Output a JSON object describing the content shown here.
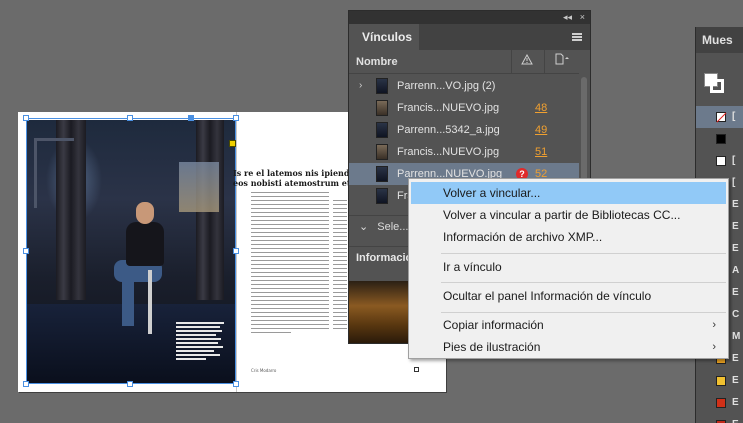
{
  "document": {
    "headline_line1": "Is re el latemos nis ipienda",
    "headline_line2": "eos nobisti atemostrum et et",
    "footer_text": "Cris Modarro"
  },
  "links_panel": {
    "title": "Vínculos",
    "collapse_glyph": "◂◂",
    "close_glyph": "×",
    "column_name": "Nombre",
    "column_status_icon": "warning-icon",
    "column_page_icon": "page-icon",
    "rows": [
      {
        "twisty": "›",
        "name": "Parrenn...VO.jpg (2)",
        "page": "",
        "missing": false
      },
      {
        "twisty": "",
        "name": "Francis...NUEVO.jpg",
        "page": "48",
        "missing": false
      },
      {
        "twisty": "",
        "name": "Parrenn...5342_a.jpg",
        "page": "49",
        "missing": false
      },
      {
        "twisty": "",
        "name": "Francis...NUEVO.jpg",
        "page": "51",
        "missing": false
      },
      {
        "twisty": "",
        "name": "Parrenn...NUEVO.jpg",
        "page": "52",
        "missing": true,
        "selected": true
      },
      {
        "twisty": "",
        "name": "Fra",
        "page": "",
        "missing": false
      }
    ],
    "missing_glyph": "?",
    "selection_label": "Sele...",
    "info_label": "Informació"
  },
  "swatches_panel": {
    "title": "Mues",
    "items": [
      {
        "label": "[",
        "color": "none",
        "selected": true
      },
      {
        "label": "",
        "color": "#000000"
      },
      {
        "label": "[",
        "color": "#ffffff"
      },
      {
        "label": "[",
        "color": "#ffffff"
      },
      {
        "label": "E",
        "color": "#2a2a2a"
      },
      {
        "label": "E",
        "color": "#3a3a3a"
      },
      {
        "label": "E",
        "color": "#4a4a4a"
      },
      {
        "label": "A",
        "color": "#5a5a5a"
      },
      {
        "label": "E",
        "color": "#4a4a4a"
      },
      {
        "label": "C",
        "color": "#5a5a5a"
      },
      {
        "label": "M",
        "color": "#555555"
      },
      {
        "label": "E",
        "color": "#e8a020"
      },
      {
        "label": "E",
        "color": "#f0c030"
      },
      {
        "label": "E",
        "color": "#d03018"
      },
      {
        "label": "E",
        "color": "#c02818"
      }
    ]
  },
  "context_menu": {
    "items": [
      {
        "label": "Volver a vincular...",
        "highlighted": true,
        "submenu": false
      },
      {
        "label": "Volver a vincular a partir de Bibliotecas CC...",
        "submenu": false
      },
      {
        "label": "Información de archivo XMP...",
        "submenu": false
      },
      {
        "label": "Ir a vínculo",
        "submenu": false
      },
      {
        "label": "Ocultar el panel Información de vínculo",
        "submenu": false
      },
      {
        "label": "Copiar información",
        "submenu": true
      },
      {
        "label": "Pies de ilustración",
        "submenu": true
      }
    ],
    "submenu_glyph": "›"
  },
  "colors": {
    "canvas": "#6b6b6b",
    "panel": "#535353",
    "selection_blue": "#4a90e2",
    "highlight": "#91c9f7",
    "page_link_orange": "#f0a030",
    "missing_red": "#e02a2a"
  }
}
